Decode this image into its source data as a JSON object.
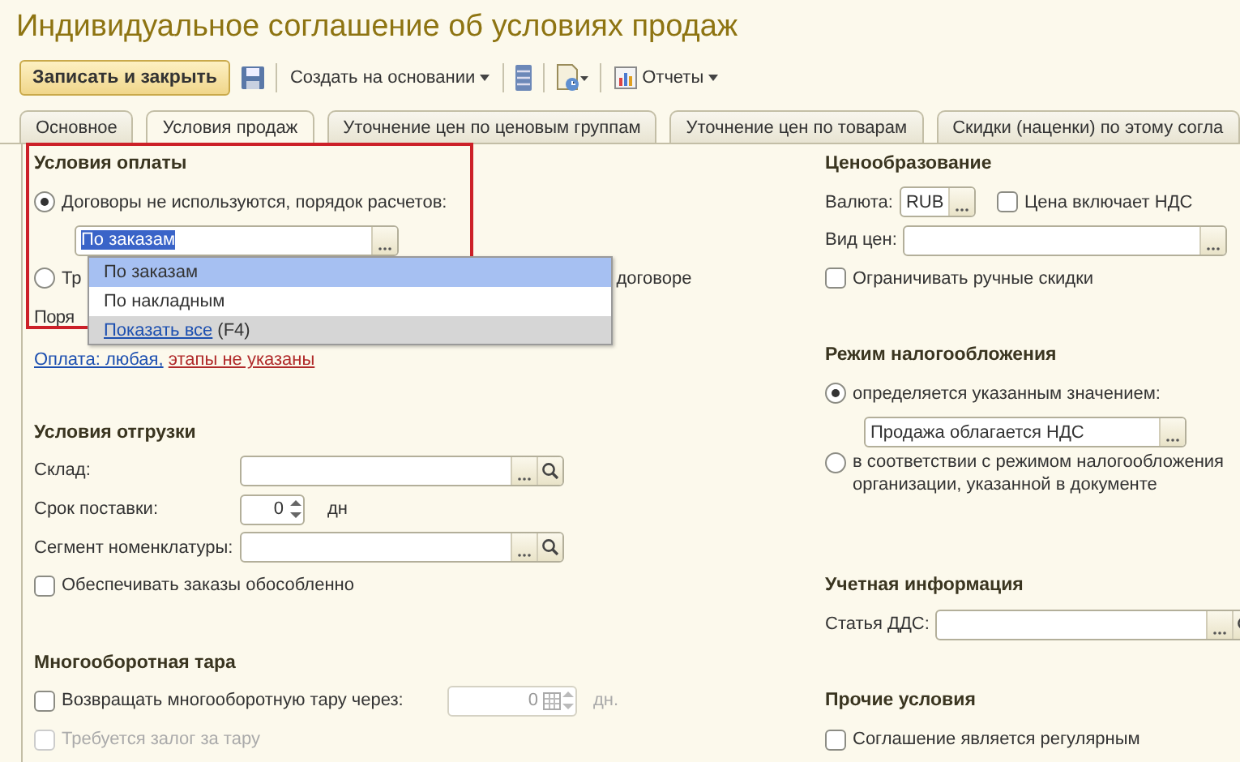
{
  "window": {
    "title": "Индивидуальное соглашение об условиях продаж"
  },
  "toolbar": {
    "save_close": "Записать и закрыть",
    "create_based_on": "Создать на основании",
    "reports": "Отчеты"
  },
  "tabs": [
    {
      "label": "Основное",
      "selected": false
    },
    {
      "label": "Условия продаж",
      "selected": true
    },
    {
      "label": "Уточнение цен по ценовым группам",
      "selected": false
    },
    {
      "label": "Уточнение цен по товарам",
      "selected": false
    },
    {
      "label": "Скидки (наценки) по этому согла",
      "selected": false
    }
  ],
  "payment": {
    "heading": "Условия оплаты",
    "option_main": {
      "label": "Договоры не используются, порядок расчетов:",
      "selected": true
    },
    "order_field": {
      "value": "По заказам"
    },
    "option_other": {
      "label_start": "Тр",
      "label_end": "договоре",
      "selected": false
    },
    "covered_label": "Поря",
    "terms_link": "Оплата: любая,",
    "terms_note": "этапы не указаны",
    "dropdown": {
      "items": [
        {
          "label": "По заказам",
          "selected": true
        },
        {
          "label": "По накладным",
          "selected": false
        }
      ],
      "show_all": "Показать все",
      "show_all_key": "(F4)"
    }
  },
  "shipment": {
    "heading": "Условия отгрузки",
    "rows": [
      {
        "kind": "lookup",
        "label": "Склад:"
      },
      {
        "kind": "number",
        "label": "Срок поставки:",
        "value": "0",
        "unit": "дн"
      },
      {
        "kind": "lookup",
        "label": "Сегмент номенклатуры:"
      },
      {
        "kind": "checkbox",
        "label": "Обеспечивать заказы обособленно",
        "checked": false
      }
    ]
  },
  "containers": {
    "heading": "Многооборотная тара",
    "return": {
      "label": "Возвращать многооборотную тару через:",
      "checked": false,
      "value": "0",
      "unit": "дн."
    },
    "deposit": {
      "label": "Требуется залог за тару",
      "checked": false,
      "disabled": true
    }
  },
  "pricing": {
    "heading": "Ценообразование",
    "currency_label": "Валюта:",
    "currency": "RUB",
    "vat_included": {
      "label": "Цена включает НДС",
      "checked": false
    },
    "price_type_label": "Вид цен:",
    "limit_discounts": {
      "label": "Ограничивать ручные скидки",
      "checked": false
    }
  },
  "taxation": {
    "heading": "Режим налогообложения",
    "options": [
      {
        "label": "определяется указанным значением:",
        "selected": true
      },
      {
        "label": "в соответствии с режимом налогообложения организации, указанной в документе",
        "selected": false
      }
    ],
    "value": "Продажа облагается НДС"
  },
  "accounting": {
    "heading": "Учетная информация",
    "cash_flow_label": "Статья ДДС:"
  },
  "other": {
    "heading": "Прочие условия",
    "regular": {
      "label": "Соглашение является регулярным",
      "checked": false
    }
  }
}
